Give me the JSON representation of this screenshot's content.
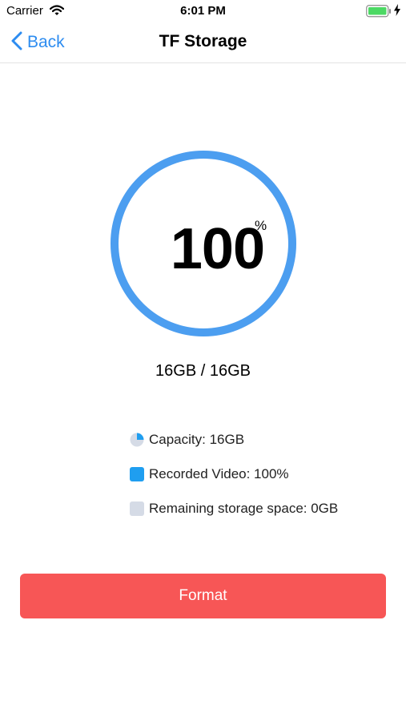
{
  "status_bar": {
    "carrier": "Carrier",
    "time": "6:01 PM",
    "wifi_icon": "wifi-icon",
    "battery_icon": "battery-icon",
    "charging_icon": "charging-bolt-icon",
    "battery_color": "#4cd964"
  },
  "nav": {
    "back_label": "Back",
    "back_icon": "chevron-left-icon",
    "title": "TF Storage",
    "accent_color": "#2d8cf0"
  },
  "storage": {
    "percent": "100",
    "percent_sign": "%",
    "used_fraction": 1.0,
    "usage_text": "16GB / 16GB",
    "ring_color": "#4c9ef0"
  },
  "legend": [
    {
      "label": "Capacity: 16GB",
      "icon": "pie-chart-icon"
    },
    {
      "label": "Recorded Video: 100%",
      "icon": "swatch-blue",
      "color": "#1f9ef0"
    },
    {
      "label": "Remaining storage space: 0GB",
      "icon": "swatch-gray",
      "color": "#d5dbe6"
    }
  ],
  "format_button": {
    "label": "Format",
    "color": "#f75656"
  }
}
